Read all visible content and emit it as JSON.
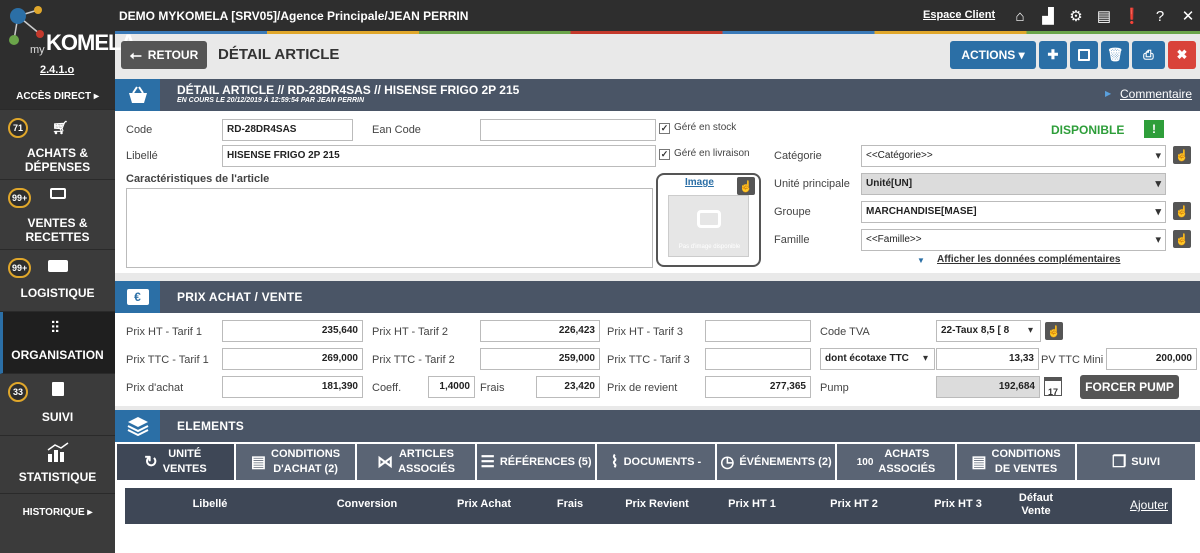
{
  "app": {
    "logo_text": "KOMELA",
    "logo_my": "my",
    "version": "2.4.1.o",
    "title": "DEMO MYKOMELA [SRV05]/Agence Principale/JEAN PERRIN",
    "espace_client": "Espace Client"
  },
  "sidebar": {
    "acces_direct": "ACCÈS DIRECT ▸",
    "items": [
      {
        "badge": "71",
        "label1": "ACHATS &",
        "label2": "DÉPENSES"
      },
      {
        "badge": "99+",
        "label1": "VENTES &",
        "label2": "RECETTES"
      },
      {
        "badge": "99+",
        "label1": "LOGISTIQUE",
        "label2": ""
      },
      {
        "badge": "",
        "label1": "ORGANISATION",
        "label2": ""
      },
      {
        "badge": "33",
        "label1": "SUIVI",
        "label2": ""
      },
      {
        "badge": "",
        "label1": "STATISTIQUE",
        "label2": ""
      }
    ],
    "historique": "HISTORIQUE ▸"
  },
  "header": {
    "back_label": "RETOUR",
    "page_title": "DÉTAIL ARTICLE",
    "actions_label": "ACTIONS ▾"
  },
  "detail": {
    "title": "DÉTAIL ARTICLE // RD-28DR4SAS // HISENSE FRIGO 2P 215",
    "subtitle": "EN COURS LE 20/12/2019 À 12:59:54 PAR JEAN PERRIN",
    "commentaire": "Commentaire",
    "code_label": "Code",
    "code_value": "RD-28DR4SAS",
    "ean_label": "Ean Code",
    "ean_value": "",
    "libelle_label": "Libellé",
    "libelle_value": "HISENSE FRIGO 2P 215",
    "gere_stock": "Géré en stock",
    "gere_livraison": "Géré en livraison",
    "carac_label": "Caractéristiques de l'article",
    "image_label": "Image",
    "no_image": "Pas d'image disponible",
    "status": "DISPONIBLE",
    "status_mark": "!",
    "categorie_label": "Catégorie",
    "categorie_value": "<<Catégorie>>",
    "unite_label": "Unité principale",
    "unite_value": "Unité[UN]",
    "groupe_label": "Groupe",
    "groupe_value": "MARCHANDISE[MASE]",
    "famille_label": "Famille",
    "famille_value": "<<Famille>>",
    "afficher": "Afficher les données complémentaires"
  },
  "prix": {
    "title": "PRIX ACHAT / VENTE",
    "ht1_label": "Prix HT   - Tarif 1",
    "ht1": "235,640",
    "ht2_label": "Prix HT   - Tarif 2",
    "ht2": "226,423",
    "ht3_label": "Prix HT   - Tarif 3",
    "ht3": "",
    "ttc1_label": "Prix TTC - Tarif 1",
    "ttc1": "269,000",
    "ttc2_label": "Prix TTC - Tarif 2",
    "ttc2": "259,000",
    "ttc3_label": "Prix TTC - Tarif 3",
    "ttc3": "",
    "achat_label": "Prix d'achat",
    "achat": "181,390",
    "coeff_label": "Coeff.",
    "coeff": "1,4000",
    "frais_label": "Frais",
    "frais": "23,420",
    "revient_label": "Prix de revient",
    "revient": "277,365",
    "tva_label": "Code TVA",
    "tva_value": "22-Taux 8,5 [ 8",
    "ecotaxe_value": "dont écotaxe TTC",
    "ecotaxe": "13,33",
    "pv_min_label": "PV TTC Mini",
    "pv_min": "200,000",
    "pump_label": "Pump",
    "pump": "192,684",
    "pump_day": "17",
    "forcer": "FORCER PUMP"
  },
  "elements": {
    "title": "ELEMENTS",
    "tabs": [
      {
        "l1": "UNITÉ",
        "l2": "VENTES"
      },
      {
        "l1": "CONDITIONS",
        "l2": "D'ACHAT (2)"
      },
      {
        "l1": "ARTICLES",
        "l2": "ASSOCIÉS"
      },
      {
        "l1": "RÉFÉRENCES (5)",
        "l2": ""
      },
      {
        "l1": "DOCUMENTS -",
        "l2": ""
      },
      {
        "l1": "ÉVÉNEMENTS (2)",
        "l2": ""
      },
      {
        "l1": "ACHATS",
        "l2": "ASSOCIÉS"
      },
      {
        "l1": "CONDITIONS",
        "l2": "DE VENTES"
      },
      {
        "l1": "SUIVI",
        "l2": ""
      }
    ],
    "columns": [
      "Libellé",
      "Conversion",
      "Prix Achat",
      "Frais",
      "Prix Revient",
      "Prix HT 1",
      "Prix HT 2",
      "Prix HT 3",
      "Défaut",
      "Vente"
    ],
    "ajouter": "Ajouter"
  },
  "colors": {
    "accent": "#2b6fa6",
    "sidebar": "#3b3b3b",
    "section": "#4a5566",
    "status_green": "#2e9e3a",
    "danger": "#d9433a"
  }
}
